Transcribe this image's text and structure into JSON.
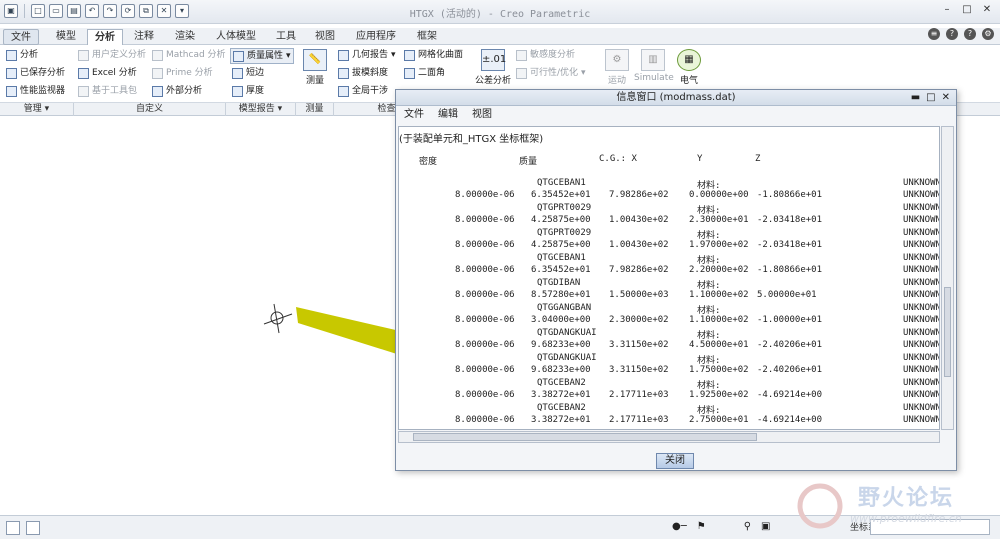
{
  "app_title": "HTGX (活动的) - Creo Parametric",
  "menu_tabs": [
    "文件",
    "模型",
    "分析",
    "注释",
    "渲染",
    "人体模型",
    "工具",
    "视图",
    "应用程序",
    "框架"
  ],
  "ribbon": {
    "manage": [
      "分析",
      "已保存分析",
      "性能监视器"
    ],
    "custom": [
      "用户定义分析",
      "Mathcad 分析",
      "Excel 分析",
      "Prime 分析",
      "基于工具包",
      "外部分析"
    ],
    "model_report": [
      "质量属性",
      "短边",
      "厚度"
    ],
    "measure": "测量",
    "inspect": [
      "几何报告",
      "网格化曲面",
      "拔模斜度",
      "二面角",
      "全局干涉"
    ],
    "tolerance": [
      "公差分析",
      "敏感度分析",
      "可行性/优化"
    ],
    "tolerance_icon": "±.01",
    "motion": [
      "运动",
      "Simulate",
      "电气"
    ]
  },
  "groups": [
    "管理",
    "自定义",
    "模型报告",
    "测量",
    "检查"
  ],
  "info_window": {
    "title": "信息窗口 (modmass.dat)",
    "menu": [
      "文件",
      "编辑",
      "视图"
    ],
    "header_line": "(于装配单元和_HTGX 坐标框架)",
    "columns": [
      "密度",
      "质量",
      "C.G.: X",
      "Y",
      "Z"
    ],
    "material_label": "材料:",
    "unknown": "UNKNOWN",
    "rows": [
      {
        "name": "QTGCEBAN1",
        "density": "8.00000e-06",
        "mass": "6.35452e+01",
        "x": "7.98286e+02",
        "y": "0.00000e+00",
        "z": "-1.80866e+01"
      },
      {
        "name": "QTGPRT0029",
        "density": "8.00000e-06",
        "mass": "4.25875e+00",
        "x": "1.00430e+02",
        "y": "2.30000e+01",
        "z": "-2.03418e+01"
      },
      {
        "name": "QTGPRT0029",
        "density": "8.00000e-06",
        "mass": "4.25875e+00",
        "x": "1.00430e+02",
        "y": "1.97000e+02",
        "z": "-2.03418e+01"
      },
      {
        "name": "QTGCEBAN1",
        "density": "8.00000e-06",
        "mass": "6.35452e+01",
        "x": "7.98286e+02",
        "y": "2.20000e+02",
        "z": "-1.80866e+01"
      },
      {
        "name": "QTGDIBAN",
        "density": "8.00000e-06",
        "mass": "8.57280e+01",
        "x": "1.50000e+03",
        "y": "1.10000e+02",
        "z": "5.00000e+01"
      },
      {
        "name": "QTGGANGBAN",
        "density": "8.00000e-06",
        "mass": "3.04000e+00",
        "x": "2.30000e+02",
        "y": "1.10000e+02",
        "z": "-1.00000e+01"
      },
      {
        "name": "QTGDANGKUAI",
        "density": "8.00000e-06",
        "mass": "9.68233e+00",
        "x": "3.31150e+02",
        "y": "4.50000e+01",
        "z": "-2.40206e+01"
      },
      {
        "name": "QTGDANGKUAI",
        "density": "8.00000e-06",
        "mass": "9.68233e+00",
        "x": "3.31150e+02",
        "y": "1.75000e+02",
        "z": "-2.40206e+01"
      },
      {
        "name": "QTGCEBAN2",
        "density": "8.00000e-06",
        "mass": "3.38272e+01",
        "x": "2.17711e+03",
        "y": "1.92500e+02",
        "z": "-4.69214e+00"
      },
      {
        "name": "QTGCEBAN2",
        "density": "8.00000e-06",
        "mass": "3.38272e+01",
        "x": "2.17711e+03",
        "y": "2.75000e+01",
        "z": "-4.69214e+00"
      }
    ],
    "close_label": "关闭"
  },
  "status": {
    "coord_label": "坐标系"
  },
  "watermark": {
    "text": "野火论坛",
    "url": "www.proewildfire.cn"
  },
  "colors": {
    "part_yellow": "#c8c800",
    "accent": "#3b6fb6"
  }
}
